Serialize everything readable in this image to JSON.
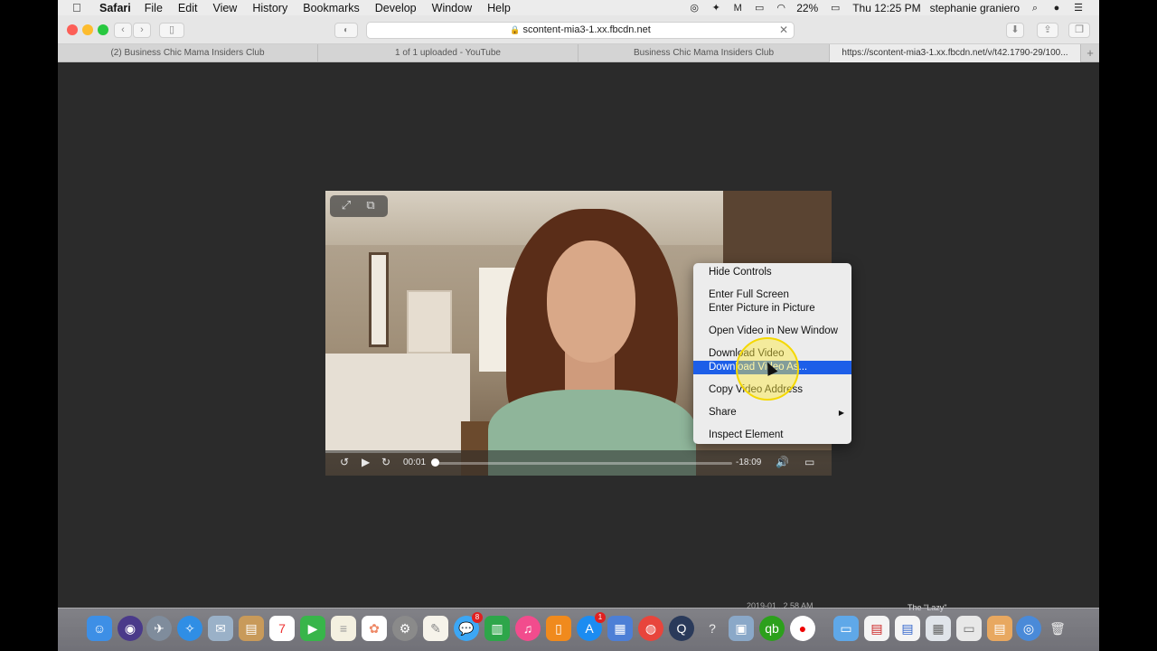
{
  "menubar": {
    "app_name": "Safari",
    "items": [
      "File",
      "Edit",
      "View",
      "History",
      "Bookmarks",
      "Develop",
      "Window",
      "Help"
    ],
    "battery": "22%",
    "clock": "Thu 12:25 PM",
    "user": "stephanie graniero"
  },
  "toolbar": {
    "address": "scontent-mia3-1.xx.fbcdn.net"
  },
  "tabs": [
    {
      "label": "(2) Business Chic Mama Insiders Club"
    },
    {
      "label": "1 of 1 uploaded - YouTube"
    },
    {
      "label": "Business Chic Mama Insiders Club"
    },
    {
      "label": "https://scontent-mia3-1.xx.fbcdn.net/v/t42.1790-29/100..."
    }
  ],
  "video": {
    "elapsed": "00:01",
    "remaining": "-18:09",
    "progress_fraction": 0.003
  },
  "context_menu": {
    "items": [
      {
        "label": "Hide Controls"
      },
      {
        "label": "Enter Full Screen"
      },
      {
        "label": "Enter Picture in Picture"
      },
      {
        "label": "Open Video in New Window"
      },
      {
        "label": "Download Video"
      },
      {
        "label": "Download Video As..."
      },
      {
        "label": "Copy Video Address"
      },
      {
        "label": "Share"
      },
      {
        "label": "Inspect Element"
      }
    ],
    "selected": "Download Video As..."
  },
  "dock": {
    "labels": [
      "2019-01...2.58 AM",
      "The \"Lazy\""
    ],
    "badges": [
      "8",
      "1"
    ],
    "calendar_day": "7"
  }
}
